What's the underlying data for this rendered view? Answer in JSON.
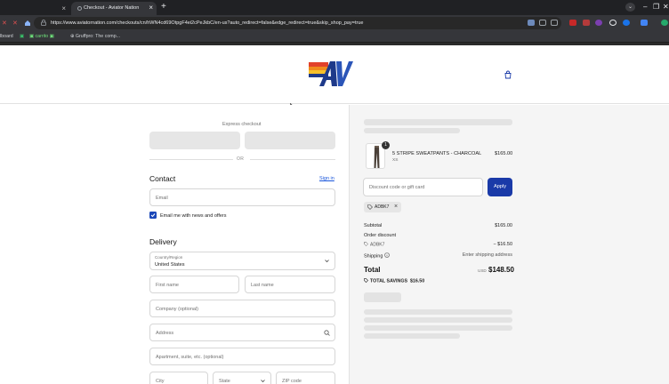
{
  "browser": {
    "prev_tab_close": "×",
    "active_tab_title": "Checkout - Aviator Nation",
    "tab_close": "×",
    "new_tab": "+",
    "url": "https://www.aviatornation.com/checkouts/cn/hWN4cd69OtpgF4ei2cPeJkbC/en-us?auto_redirect=false&edge_redirect=true&skip_shop_pay=true",
    "window_controls": [
      "–",
      "❐",
      "✕"
    ],
    "tab_search": "⌄",
    "bookmarks": [
      "lboard",
      "carrito",
      "Gruffpro: The comp..."
    ]
  },
  "store": {
    "cart_label": "Cart"
  },
  "express_checkout": {
    "label": "Express checkout",
    "divider": "OR"
  },
  "contact": {
    "heading": "Contact",
    "sign_in": "Sign in",
    "email_placeholder": "Email",
    "newsletter_label": "Email me with news and offers",
    "newsletter_checked": true
  },
  "delivery": {
    "heading": "Delivery",
    "country_label": "Country/Region",
    "country_value": "United States",
    "first_name": "First name",
    "last_name": "Last name",
    "company": "Company (optional)",
    "address": "Address",
    "apartment": "Apartment, suite, etc. (optional)",
    "city": "City",
    "state": "State",
    "zip": "ZIP code"
  },
  "summary": {
    "item": {
      "quantity": "1",
      "name": "5 STRIPE SWEATPANTS - CHARCOAL",
      "variant": "XS",
      "price": "$165.00"
    },
    "discount_placeholder": "Discount code or gift card",
    "apply_label": "Apply",
    "applied_code": "ADBK7",
    "remove_code": "×",
    "subtotal_label": "Subtotal",
    "subtotal_value": "$165.00",
    "order_discount_label": "Order discount",
    "order_discount_code": "ADBK7",
    "order_discount_value": "− $16.50",
    "shipping_label": "Shipping",
    "shipping_value": "Enter shipping address",
    "total_label": "Total",
    "total_currency": "USD",
    "total_value": "$148.50",
    "savings_label": "TOTAL SAVINGS",
    "savings_value": "$16.50"
  },
  "colors": {
    "accent_blue": "#1a3aa8",
    "link_blue": "#1a56db",
    "summary_bg": "#f5f5f5"
  }
}
